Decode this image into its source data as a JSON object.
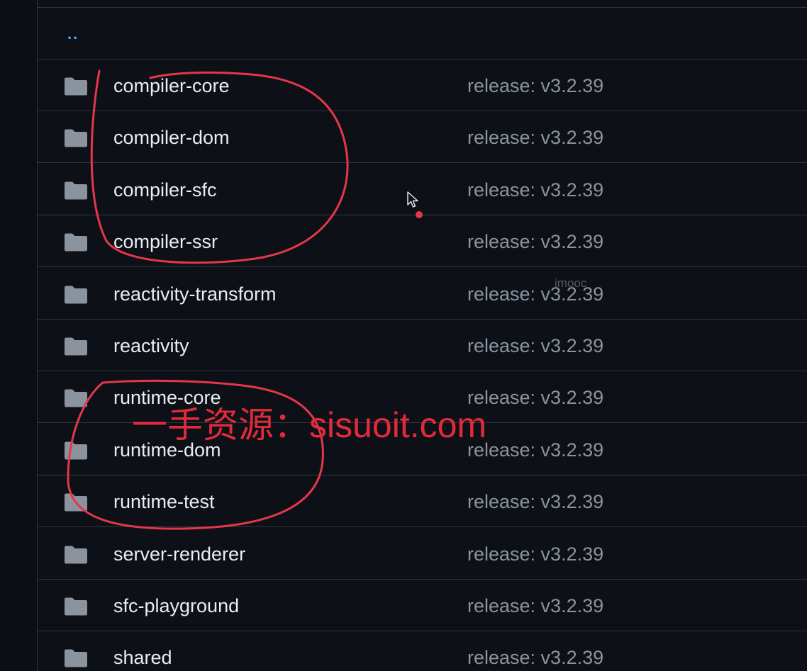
{
  "parent_link": "..",
  "rows": [
    {
      "name": "compiler-core",
      "commit": "release: v3.2.39",
      "icon": "folder-icon"
    },
    {
      "name": "compiler-dom",
      "commit": "release: v3.2.39",
      "icon": "folder-icon"
    },
    {
      "name": "compiler-sfc",
      "commit": "release: v3.2.39",
      "icon": "folder-icon"
    },
    {
      "name": "compiler-ssr",
      "commit": "release: v3.2.39",
      "icon": "folder-icon"
    },
    {
      "name": "reactivity-transform",
      "commit": "release: v3.2.39",
      "icon": "folder-icon"
    },
    {
      "name": "reactivity",
      "commit": "release: v3.2.39",
      "icon": "folder-icon"
    },
    {
      "name": "runtime-core",
      "commit": "release: v3.2.39",
      "icon": "folder-icon"
    },
    {
      "name": "runtime-dom",
      "commit": "release: v3.2.39",
      "icon": "folder-icon"
    },
    {
      "name": "runtime-test",
      "commit": "release: v3.2.39",
      "icon": "folder-icon"
    },
    {
      "name": "server-renderer",
      "commit": "release: v3.2.39",
      "icon": "folder-icon"
    },
    {
      "name": "sfc-playground",
      "commit": "release: v3.2.39",
      "icon": "folder-icon"
    },
    {
      "name": "shared",
      "commit": "release: v3.2.39",
      "icon": "folder-icon"
    }
  ],
  "watermarks": {
    "small": "imooc",
    "big": "一手资源：sisuoit.com"
  },
  "colors": {
    "background": "#0d1117",
    "border": "#30363d",
    "link": "#58a6ff",
    "folder": "#8b949e",
    "annotation": "#e5364b"
  }
}
